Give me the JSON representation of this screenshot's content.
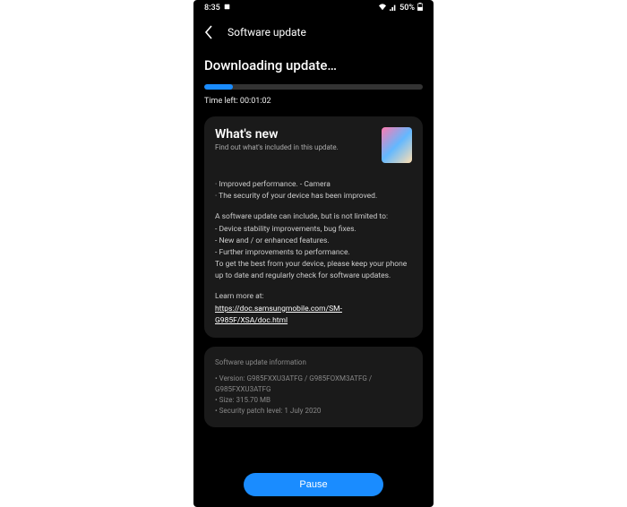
{
  "status": {
    "time": "8:35",
    "battery_pct": "50%"
  },
  "header": {
    "title": "Software update"
  },
  "download": {
    "title": "Downloading update…",
    "time_left_label": "Time left: 00:01:02",
    "progress_pct": 13
  },
  "whats_new": {
    "title": "What's new",
    "subtitle": "Find out what's included in this update."
  },
  "changelog": {
    "bullets_1": "· Improved performance. - Camera\n· The security of your device has been improved.",
    "intro": "A software update can include, but is not limited to:",
    "items": " - Device stability improvements, bug fixes.\n - New and / or enhanced features.\n - Further improvements to performance.",
    "keep": "To get the best from your device, please keep your phone up to date and regularly check for software updates.",
    "learn_label": "Learn more at:",
    "learn_url": "https://doc.samsungmobile.com/SM-G985F/XSA/doc.html"
  },
  "update_info": {
    "heading": "Software update information",
    "version": "• Version: G985FXXU3ATFG / G985FOXM3ATFG / G985FXXU3ATFG",
    "size": "• Size: 315.70 MB",
    "patch": "• Security patch level: 1 July 2020"
  },
  "buttons": {
    "pause": "Pause"
  }
}
